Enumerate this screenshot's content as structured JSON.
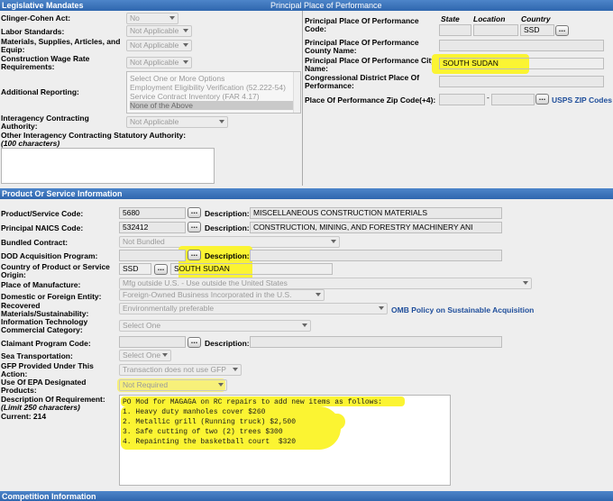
{
  "legislative": {
    "title": "Legislative Mandates",
    "clinger_label": "Clinger-Cohen Act:",
    "clinger_value": "No",
    "labor_label": "Labor Standards:",
    "labor_value": "Not Applicable",
    "materials_label": "Materials, Supplies, Articles, and Equip:",
    "materials_value": "Not Applicable",
    "construction_label": "Construction Wage Rate Requirements:",
    "construction_value": "Not Applicable",
    "additional_label": "Additional Reporting:",
    "additional_options": [
      "Select One or More Options",
      "Employment Eligibility Verification (52.222-54)",
      "Service Contract Inventory (FAR 4.17)",
      "None of the Above"
    ],
    "interagency_label": "Interagency Contracting Authority:",
    "interagency_value": "Not Applicable",
    "other_label": "Other Interagency Contracting Statutory Authority:",
    "other_hint": "(100 characters)"
  },
  "ppop": {
    "title": "Principal Place of Performance",
    "code_label": "Principal Place Of Performance Code:",
    "col_state": "State",
    "col_location": "Location",
    "col_country": "Country",
    "country_value": "SSD",
    "county_label": "Principal Place Of Performance County Name:",
    "city_label": "Principal Place Of Performance City Name:",
    "city_value": "SOUTH SUDAN",
    "congress_label": "Congressional District Place Of Performance:",
    "zip_label": "Place Of Performance Zip Code(+4):",
    "zip_dash": "-",
    "zip_link": "USPS ZIP Codes"
  },
  "product": {
    "title": "Product Or Service Information",
    "psc_label": "Product/Service Code:",
    "psc_value": "5680",
    "desc_label": "Description:",
    "psc_desc": "MISCELLANEOUS CONSTRUCTION MATERIALS",
    "naics_label": "Principal NAICS Code:",
    "naics_value": "532412",
    "naics_desc": "CONSTRUCTION, MINING, AND FORESTRY MACHINERY ANI",
    "bundled_label": "Bundled Contract:",
    "bundled_value": "Not Bundled",
    "dod_label": "DOD Acquisition Program:",
    "country_label": "Country of Product or Service Origin:",
    "country_code": "SSD",
    "country_name": "SOUTH SUDAN",
    "manufacture_label": "Place of Manufacture:",
    "manufacture_value": "Mfg outside U.S. - Use outside the United States",
    "domestic_label": "Domestic or Foreign Entity:",
    "domestic_value": "Foreign-Owned Business Incorporated in the U.S.",
    "recovered_label": "Recovered Materials/Sustainability:",
    "recovered_value": "Environmentally preferable",
    "omb_link": "OMB Policy on Sustainable Acquisition",
    "it_label": "Information Technology Commercial Category:",
    "it_value": "Select One",
    "claimant_label": "Claimant Program Code:",
    "sea_label": "Sea Transportation:",
    "sea_value": "Select One",
    "gfp_label": "GFP Provided Under This Action:",
    "gfp_value": "Transaction does not use GFP",
    "epa_label": "Use Of EPA Designated Products:",
    "epa_value": "Not Required",
    "req_label": "Description Of Requirement:",
    "req_limit": "(Limit 250 characters)",
    "req_current": "Current: 214",
    "req_text": "PO Mod for MAGAGA on RC repairs to add new items as follows:\n1. Heavy duty manholes cover $260\n2. Metallic grill (Running truck) $2,500\n3. Safe cutting of two (2) trees $300\n4. Repainting the basketball court  $320"
  },
  "competition": {
    "title": "Competition Information"
  },
  "icons": {
    "lookup": "ellipsis-lookup-icon",
    "dropdown": "chevron-down-icon"
  },
  "colors": {
    "header_bar": "#3a72b8",
    "highlight": "#fbf432",
    "link": "#1f4e9b"
  }
}
